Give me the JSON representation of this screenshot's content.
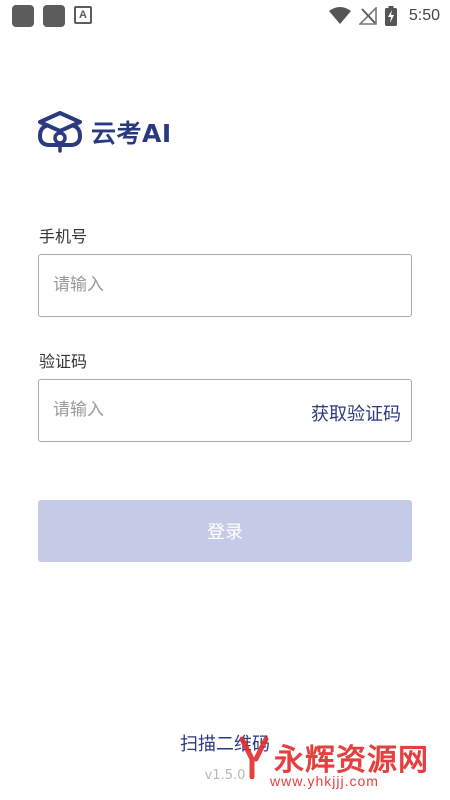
{
  "status_bar": {
    "time": "5:50",
    "notification_letter": "A",
    "icons": [
      "app-icon",
      "app-icon",
      "notification-icon",
      "wifi-icon",
      "no-signal-icon",
      "battery-charging-icon"
    ]
  },
  "brand": {
    "name": "云考AI",
    "color": "#2b3a7e"
  },
  "form": {
    "phone_label": "手机号",
    "phone_placeholder": "请输入",
    "code_label": "验证码",
    "code_placeholder": "请输入",
    "get_code_label": "获取验证码",
    "login_label": "登录"
  },
  "footer": {
    "scan_link": "扫描二维码",
    "version": "v1.5.0"
  },
  "watermark": {
    "text": "永辉资源网",
    "url": "www.yhkjjj.com",
    "color": "#e32b2b"
  }
}
